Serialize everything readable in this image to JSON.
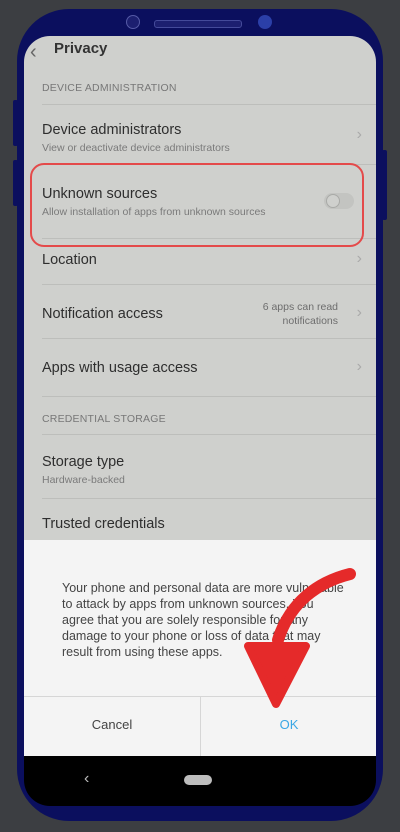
{
  "header": {
    "back_icon": "arrow-left-icon",
    "title": "Privacy"
  },
  "sections": {
    "device_admin": "DEVICE ADMINISTRATION",
    "credential": "CREDENTIAL STORAGE"
  },
  "rows": {
    "device_admins": {
      "title": "Device administrators",
      "subtitle": "View or deactivate device administrators"
    },
    "unknown_sources": {
      "title": "Unknown sources",
      "subtitle": "Allow installation of apps from unknown sources",
      "toggle_on": false
    },
    "location": {
      "title": "Location"
    },
    "notification_access": {
      "title": "Notification access",
      "detail_line1": "6 apps can read",
      "detail_line2": "notifications"
    },
    "usage_access": {
      "title": "Apps with usage access"
    },
    "storage_type": {
      "title": "Storage type",
      "subtitle": "Hardware-backed"
    },
    "trusted_credentials": {
      "title": "Trusted credentials"
    }
  },
  "dialog": {
    "message": "Your phone and personal data are more vulnerable to attack by apps from unknown sources. You agree that you are solely responsible for any damage to your phone or loss of data that may result from using these apps.",
    "cancel_label": "Cancel",
    "ok_label": "OK"
  },
  "colors": {
    "phone_frame": "#0b0f5e",
    "highlight": "#e44a4a",
    "ok_text": "#3aa7e5",
    "annotation_arrow": "#e52a2a"
  },
  "icons": {
    "chevron": "chevron-right-icon",
    "nav_back": "nav-back-icon",
    "nav_home": "nav-home-pill"
  }
}
